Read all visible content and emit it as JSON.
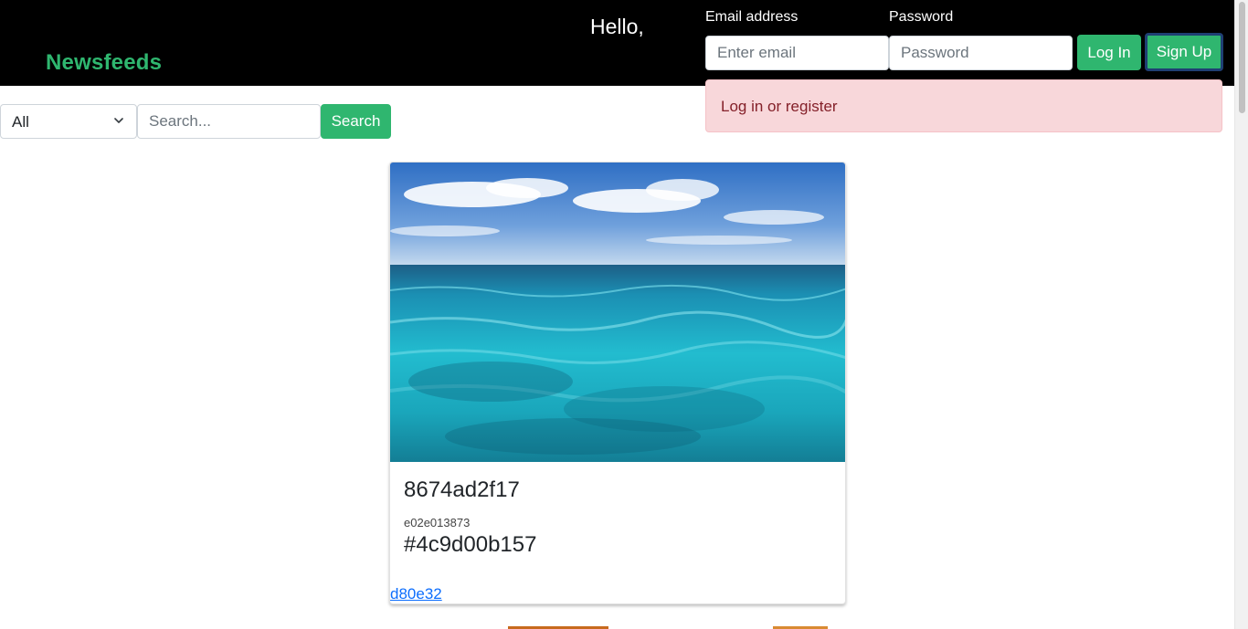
{
  "header": {
    "brand": "Newsfeeds",
    "greeting": "Hello,",
    "email_label": "Email address",
    "email_placeholder": "Enter email",
    "password_label": "Password",
    "password_placeholder": "Password",
    "login_label": "Log In",
    "signup_label": "Sign Up"
  },
  "alert": {
    "message": "Log in or register"
  },
  "filters": {
    "selected_category": "All",
    "search_placeholder": "Search...",
    "search_button_label": "Search"
  },
  "card": {
    "title": "8674ad2f17",
    "subtitle": "e02e013873",
    "tag": "#4c9d00b157",
    "link": "d80e32"
  },
  "colors": {
    "brand_green": "#2fb66f",
    "navbar": "#000000",
    "alert_bg": "#f8d7da",
    "alert_text": "#842029",
    "link": "#0d6efd"
  },
  "icons": {
    "select_chevron": "chevron-down-icon"
  }
}
